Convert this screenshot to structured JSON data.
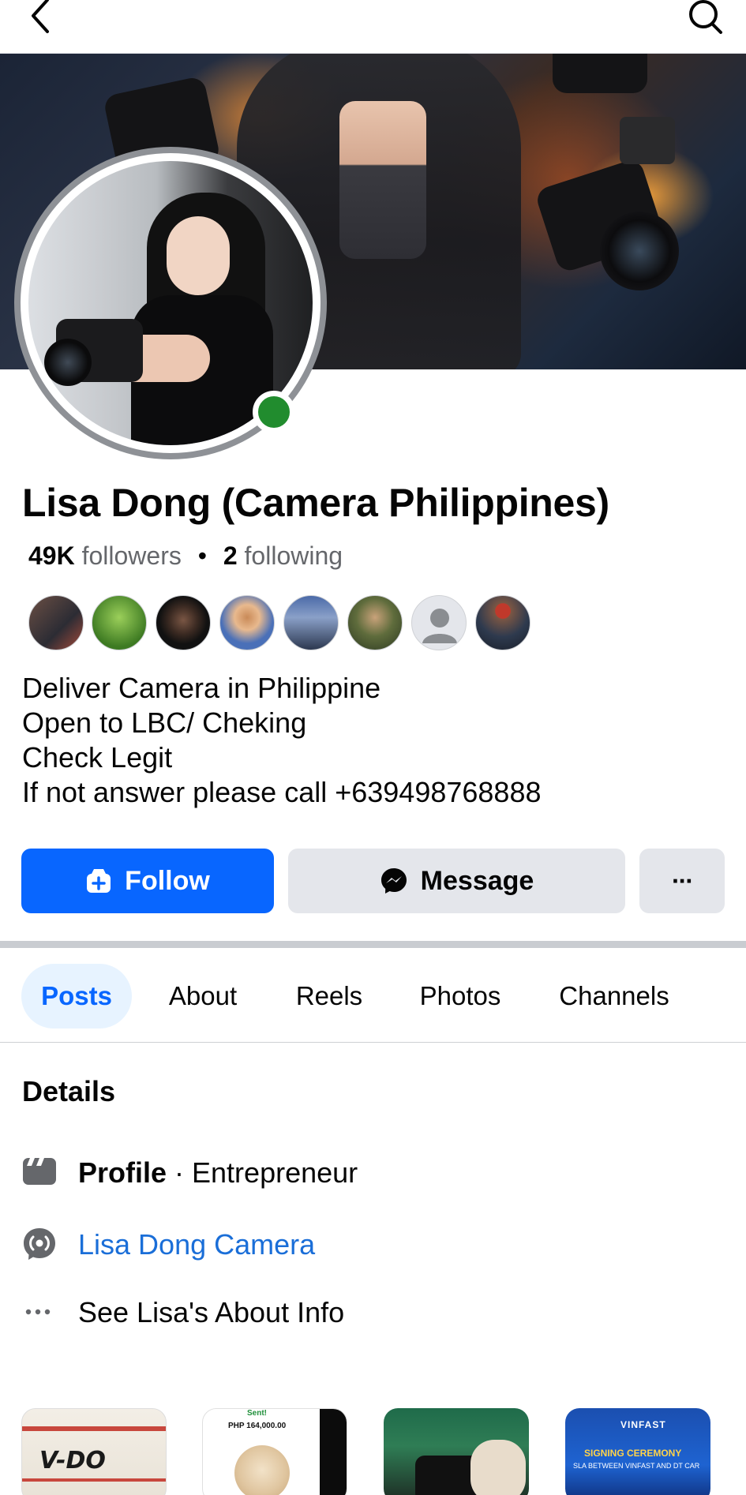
{
  "header": {
    "back_icon": "chevron-left-icon",
    "search_icon": "search-icon"
  },
  "profile": {
    "name": "Lisa Dong (Camera Philippines)",
    "followers_count": "49K",
    "followers_label": "followers",
    "separator": "•",
    "following_count": "2",
    "following_label": "following",
    "online": true
  },
  "bio": {
    "lines": [
      "Deliver Camera in Philippine",
      "Open to LBC/ Cheking",
      "Check Legit",
      "If not answer please call +639498768888"
    ]
  },
  "actions": {
    "follow_label": "Follow",
    "message_label": "Message",
    "more_label": "···",
    "accent": "#0866ff"
  },
  "tabs": [
    {
      "label": "Posts",
      "active": true
    },
    {
      "label": "About",
      "active": false
    },
    {
      "label": "Reels",
      "active": false
    },
    {
      "label": "Photos",
      "active": false
    },
    {
      "label": "Channels",
      "active": false
    }
  ],
  "details": {
    "title": "Details",
    "profile_label": "Profile",
    "profile_category": " · Entrepreneur",
    "channel_name": "Lisa Dong Camera",
    "about_link": "See Lisa's About Info"
  },
  "photos": {
    "p1": "V-DO",
    "p2_amount": "PHP 164,000.00",
    "p2_title": "Sent!",
    "p4_brand": "VINFAST",
    "p4_title": "SIGNING CEREMONY",
    "p4_sub": "SLA BETWEEN VINFAST AND DT CAR"
  }
}
